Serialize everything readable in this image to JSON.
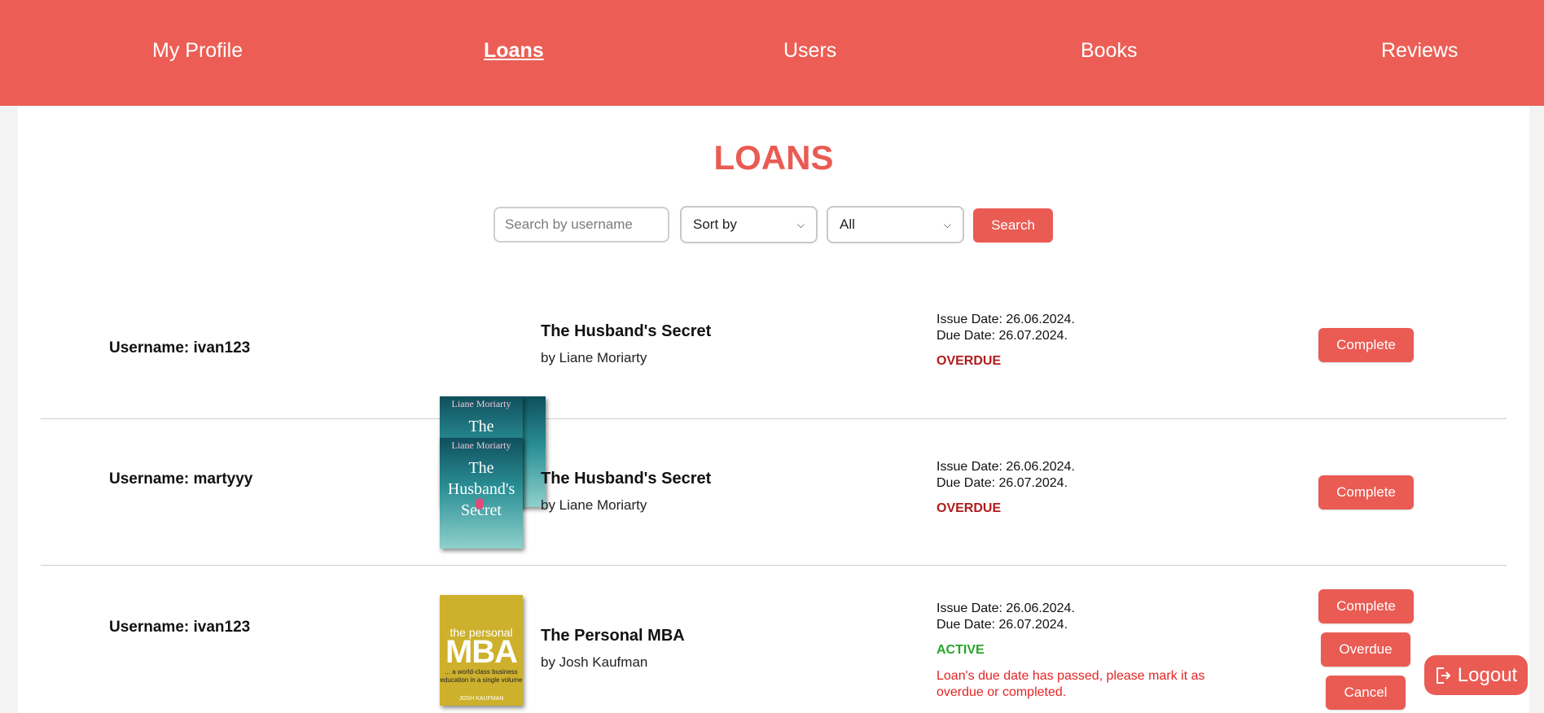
{
  "nav": {
    "items": [
      {
        "label": "My Profile",
        "active": false
      },
      {
        "label": "Loans",
        "active": true
      },
      {
        "label": "Users",
        "active": false
      },
      {
        "label": "Books",
        "active": false
      },
      {
        "label": "Reviews",
        "active": false
      }
    ]
  },
  "page": {
    "title": "LOANS",
    "search_placeholder": "Search by username",
    "sort_select": "Sort by",
    "filter_select": "All",
    "search_button": "Search"
  },
  "loans": [
    {
      "username": "Username: ivan123",
      "cover": {
        "icon": "book-cover-husbands-secret",
        "author_text": "Liane Moriarty",
        "title_text": "The Husband's Secret"
      },
      "book_title": "The Husband's Secret",
      "book_author": "by Liane Moriarty",
      "issue_date": "Issue Date: 26.06.2024.",
      "due_date": "Due Date: 26.07.2024.",
      "status": "OVERDUE",
      "actions": [
        "Complete"
      ]
    },
    {
      "username": "Username: martyyy",
      "cover": {
        "icon": "book-cover-husbands-secret",
        "author_text": "Liane Moriarty",
        "title_text": "The Husband's Secret"
      },
      "book_title": "The Husband's Secret",
      "book_author": "by Liane Moriarty",
      "issue_date": "Issue Date: 26.06.2024.",
      "due_date": "Due Date: 26.07.2024.",
      "status": "OVERDUE",
      "actions": [
        "Complete"
      ]
    },
    {
      "username": "Username: ivan123",
      "cover": {
        "icon": "book-cover-personal-mba",
        "small_text": "the personal",
        "big_text": "MBA",
        "sub_text": "... a world-class business education in a single volume",
        "author_text": "JOSH KAUFMAN"
      },
      "book_title": "The Personal MBA",
      "book_author": "by Josh Kaufman",
      "issue_date": "Issue Date: 26.06.2024.",
      "due_date": "Due Date: 26.07.2024.",
      "status": "ACTIVE",
      "warning": "Loan's due date has passed, please mark it as overdue or completed.",
      "actions": [
        "Complete",
        "Overdue",
        "Cancel"
      ]
    }
  ],
  "logout_label": "Logout",
  "colors": {
    "accent": "#ea5b53",
    "nav_bg": "#ec5e55",
    "overdue": "#b11b1b",
    "active": "#2aa52a",
    "warning": "#e32424"
  }
}
